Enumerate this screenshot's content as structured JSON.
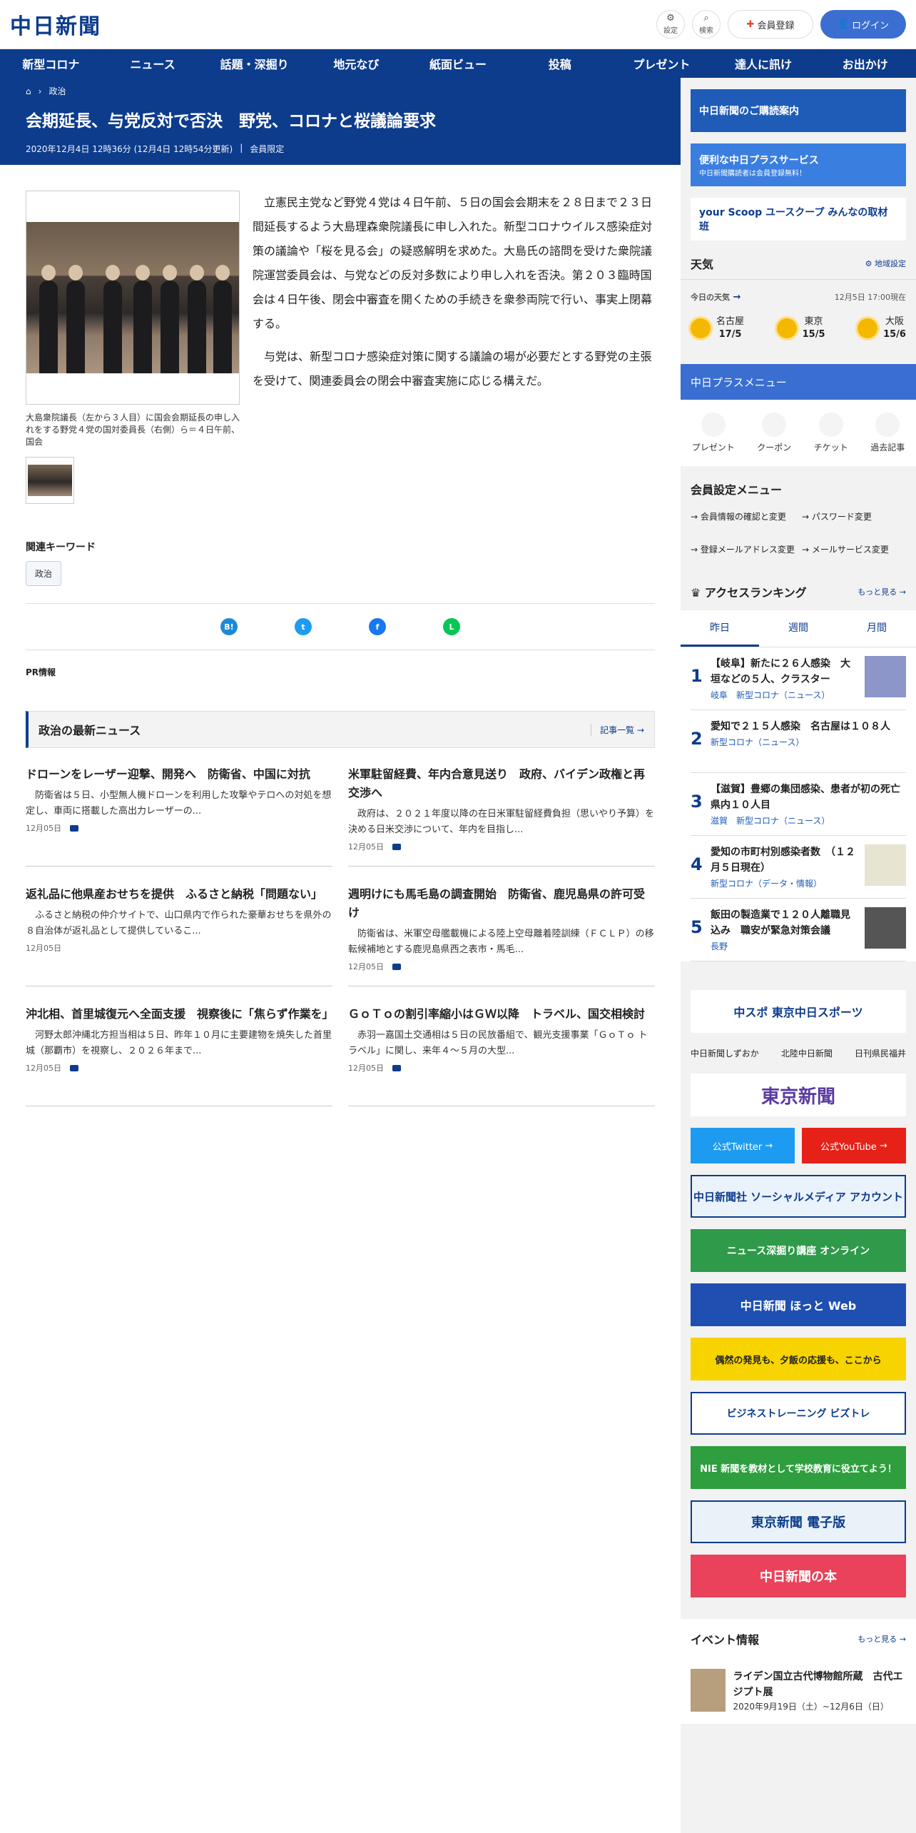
{
  "header": {
    "logo": "中日新聞",
    "settings_label": "設定",
    "search_label": "検索",
    "register_label": "会員登録",
    "login_label": "ログイン"
  },
  "nav": [
    "新型コロナ",
    "ニュース",
    "話題・深掘り",
    "地元なび",
    "紙面ビュー",
    "投稿",
    "プレゼント",
    "達人に訊け",
    "お出かけ"
  ],
  "hero": {
    "breadcrumb": "政治",
    "title": "会期延長、与党反対で否決　野党、コロナと桜議論要求",
    "date": "2020年12月4日 12時36分 (12月4日 12時54分更新)",
    "member": "会員限定"
  },
  "article": {
    "paragraphs": [
      "立憲民主党など野党４党は４日午前、５日の国会会期末を２８日まで２３日間延長するよう大島理森衆院議長に申し入れた。新型コロナウイルス感染症対策の議論や「桜を見る会」の疑惑解明を求めた。大島氏の諮問を受けた衆院議院運営委員会は、与党などの反対多数により申し入れを否決。第２０３臨時国会は４日午後、閉会中審査を開くための手続きを衆参両院で行い、事実上閉幕する。",
      "与党は、新型コロナ感染症対策に関する議論の場が必要だとする野党の主張を受けて、関連委員会の閉会中審査実施に応じる構えだ。"
    ],
    "caption": "大島衆院議長（左から３人目）に国会会期延長の申し入れをする野党４党の国対委員長（右側）ら＝４日午前、国会",
    "keyword_title": "関連キーワード",
    "keyword": "政治",
    "pr": "PR情報"
  },
  "share": {
    "hatena": "B!",
    "twitter": "t",
    "facebook": "f",
    "line": "L"
  },
  "latest": {
    "title": "政治の最新ニュース",
    "more": "記事一覧",
    "items": [
      {
        "title": "ドローンをレーザー迎撃、開発へ　防衛省、中国に対抗",
        "text": "防衛省は５日、小型無人機ドローンを利用した攻撃やテロへの対処を想定し、車両に搭載した高出力レーザーの...",
        "date": "12月05日"
      },
      {
        "title": "米軍駐留経費、年内合意見送り　政府、バイデン政権と再交渉へ",
        "text": "政府は、２０２１年度以降の在日米軍駐留経費負担（思いやり予算）を決める日米交渉について、年内を目指し...",
        "date": "12月05日"
      },
      {
        "title": "返礼品に他県産おせちを提供　ふるさと納税「問題ない」",
        "text": "ふるさと納税の仲介サイトで、山口県内で作られた豪華おせちを県外の８自治体が返礼品として提供しているこ...",
        "date": "12月05日"
      },
      {
        "title": "週明けにも馬毛島の調査開始　防衛省、鹿児島県の許可受け",
        "text": "防衛省は、米軍空母艦載機による陸上空母離着陸訓練（ＦＣＬＰ）の移転候補地とする鹿児島県西之表市・馬毛...",
        "date": "12月05日"
      },
      {
        "title": "沖北相、首里城復元へ全面支援　視察後に「焦らず作業を」",
        "text": "河野太郎沖縄北方担当相は５日、昨年１０月に主要建物を焼失した首里城（那覇市）を視察し、２０２６年まで...",
        "date": "12月05日"
      },
      {
        "title": "ＧｏＴｏの割引率縮小はＧＷ以降　トラベル、国交相検討",
        "text": "赤羽一嘉国土交通相は５日の民放番組で、観光支援事業「ＧｏＴｏ トラベル」に関し、来年４～５月の大型...",
        "date": "12月05日"
      }
    ]
  },
  "side": {
    "banner1": "中日新聞のご購読案内",
    "banner2": "便利な中日プラスサービス",
    "banner2_sub": "中日新聞購読者は会員登録無料！",
    "banner3": "your Scoop ユースクープ みんなの取材班",
    "weather_title": "天気",
    "weather_area": "地域設定",
    "weather_today": "今日の天気",
    "weather_time": "12月5日 17:00現在",
    "cities": [
      {
        "name": "名古屋",
        "temp": "17/5"
      },
      {
        "name": "東京",
        "temp": "15/5"
      },
      {
        "name": "大阪",
        "temp": "15/6"
      }
    ],
    "plus_menu_title": "中日プラスメニュー",
    "plus_menu": [
      "プレゼント",
      "クーポン",
      "チケット",
      "過去記事"
    ],
    "member_title": "会員設定メニュー",
    "member_links": [
      "会員情報の確認と変更",
      "パスワード変更",
      "登録メールアドレス変更",
      "メールサービス変更"
    ],
    "ranking_title": "アクセスランキング",
    "ranking_more": "もっと見る",
    "ranking_tabs": [
      "昨日",
      "週間",
      "月間"
    ],
    "ranking": [
      {
        "num": "1",
        "title": "【岐阜】新たに２６人感染　大垣などの５人、クラスター",
        "tag": "岐阜　新型コロナ（ニュース）"
      },
      {
        "num": "2",
        "title": "愛知で２１５人感染　名古屋は１０８人",
        "tag": "新型コロナ（ニュース）"
      },
      {
        "num": "3",
        "title": "【滋賀】豊郷の集団感染、患者が初の死亡　県内１０人目",
        "tag": "滋賀　新型コロナ（ニュース）"
      },
      {
        "num": "4",
        "title": "愛知の市町村別感染者数　（１２月５日現在）",
        "tag": "新型コロナ（データ・情報）"
      },
      {
        "num": "5",
        "title": "飯田の製造業で１２０人離職見込み　職安が緊急対策会議",
        "tag": "長野"
      }
    ],
    "chunichi_sports": "中スポ 東京中日スポーツ",
    "sister": [
      "中日新聞しずおか",
      "北陸中日新聞",
      "日刊県民福井"
    ],
    "tokyo": "東京新聞",
    "twitter": "公式Twitter",
    "youtube": "公式YouTube",
    "sns": "中日新聞社 ソーシャルメディア アカウント",
    "fukabori": "ニュース深掘り講座 オンライン",
    "hotto": "中日新聞 ほっと Web",
    "crowd": "偶然の発見も、夕飯の応援も、ここから",
    "biz": "ビジネストレーニング ビズトレ",
    "nie": "NIE 新聞を教材として学校教育に役立てよう！",
    "tokyo_e": "東京新聞 電子版",
    "book": "中日新聞の本",
    "event_title": "イベント情報",
    "event_more": "もっと見る",
    "event_item": "ライデン国立古代博物館所蔵　古代エジプト展",
    "event_date": "2020年9月19日（土）~12月6日（日）"
  }
}
